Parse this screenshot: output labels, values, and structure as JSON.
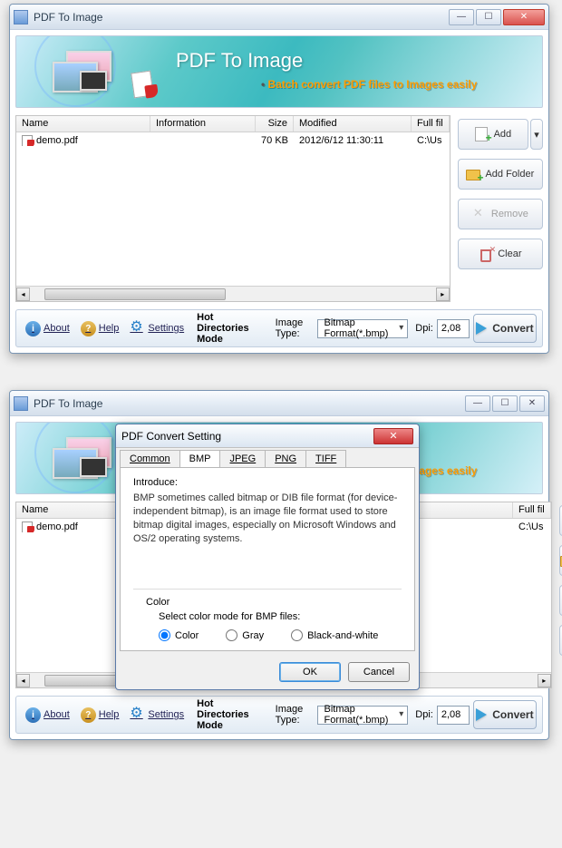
{
  "window": {
    "title": "PDF To Image"
  },
  "banner": {
    "title": "PDF To Image",
    "subtitle": "Batch convert PDF files to Images easily"
  },
  "file_list": {
    "headers": {
      "name": "Name",
      "info": "Information",
      "size": "Size",
      "modified": "Modified",
      "full": "Full fil"
    },
    "rows": [
      {
        "name": "demo.pdf",
        "info": "",
        "size": "70 KB",
        "modified": "2012/6/12 11:30:11",
        "full": "C:\\Us"
      }
    ]
  },
  "side": {
    "add": "Add",
    "add_folder": "Add Folder",
    "remove": "Remove",
    "clear": "Clear"
  },
  "bottom": {
    "about": "About",
    "help": "Help",
    "settings": "Settings",
    "hot_dirs": "Hot Directories Mode",
    "image_type": "Image Type:",
    "image_type_value": "Bitmap Format(*.bmp)",
    "dpi": "Dpi:",
    "dpi_value": "2,08",
    "convert": "Convert"
  },
  "dialog": {
    "title": "PDF Convert Setting",
    "tabs": {
      "common": "Common",
      "bmp": "BMP",
      "jpeg": "JPEG",
      "png": "PNG",
      "tiff": "TIFF"
    },
    "introduce_label": "Introduce:",
    "introduce_text": "BMP sometimes called bitmap or DIB file format (for device-independent bitmap), is an image file format used to store bitmap digital images, especially on Microsoft Windows and OS/2 operating systems.",
    "color_label": "Color",
    "color_sub": "Select color mode for BMP files:",
    "radios": {
      "color": "Color",
      "gray": "Gray",
      "bw": "Black-and-white"
    },
    "ok": "OK",
    "cancel": "Cancel"
  }
}
